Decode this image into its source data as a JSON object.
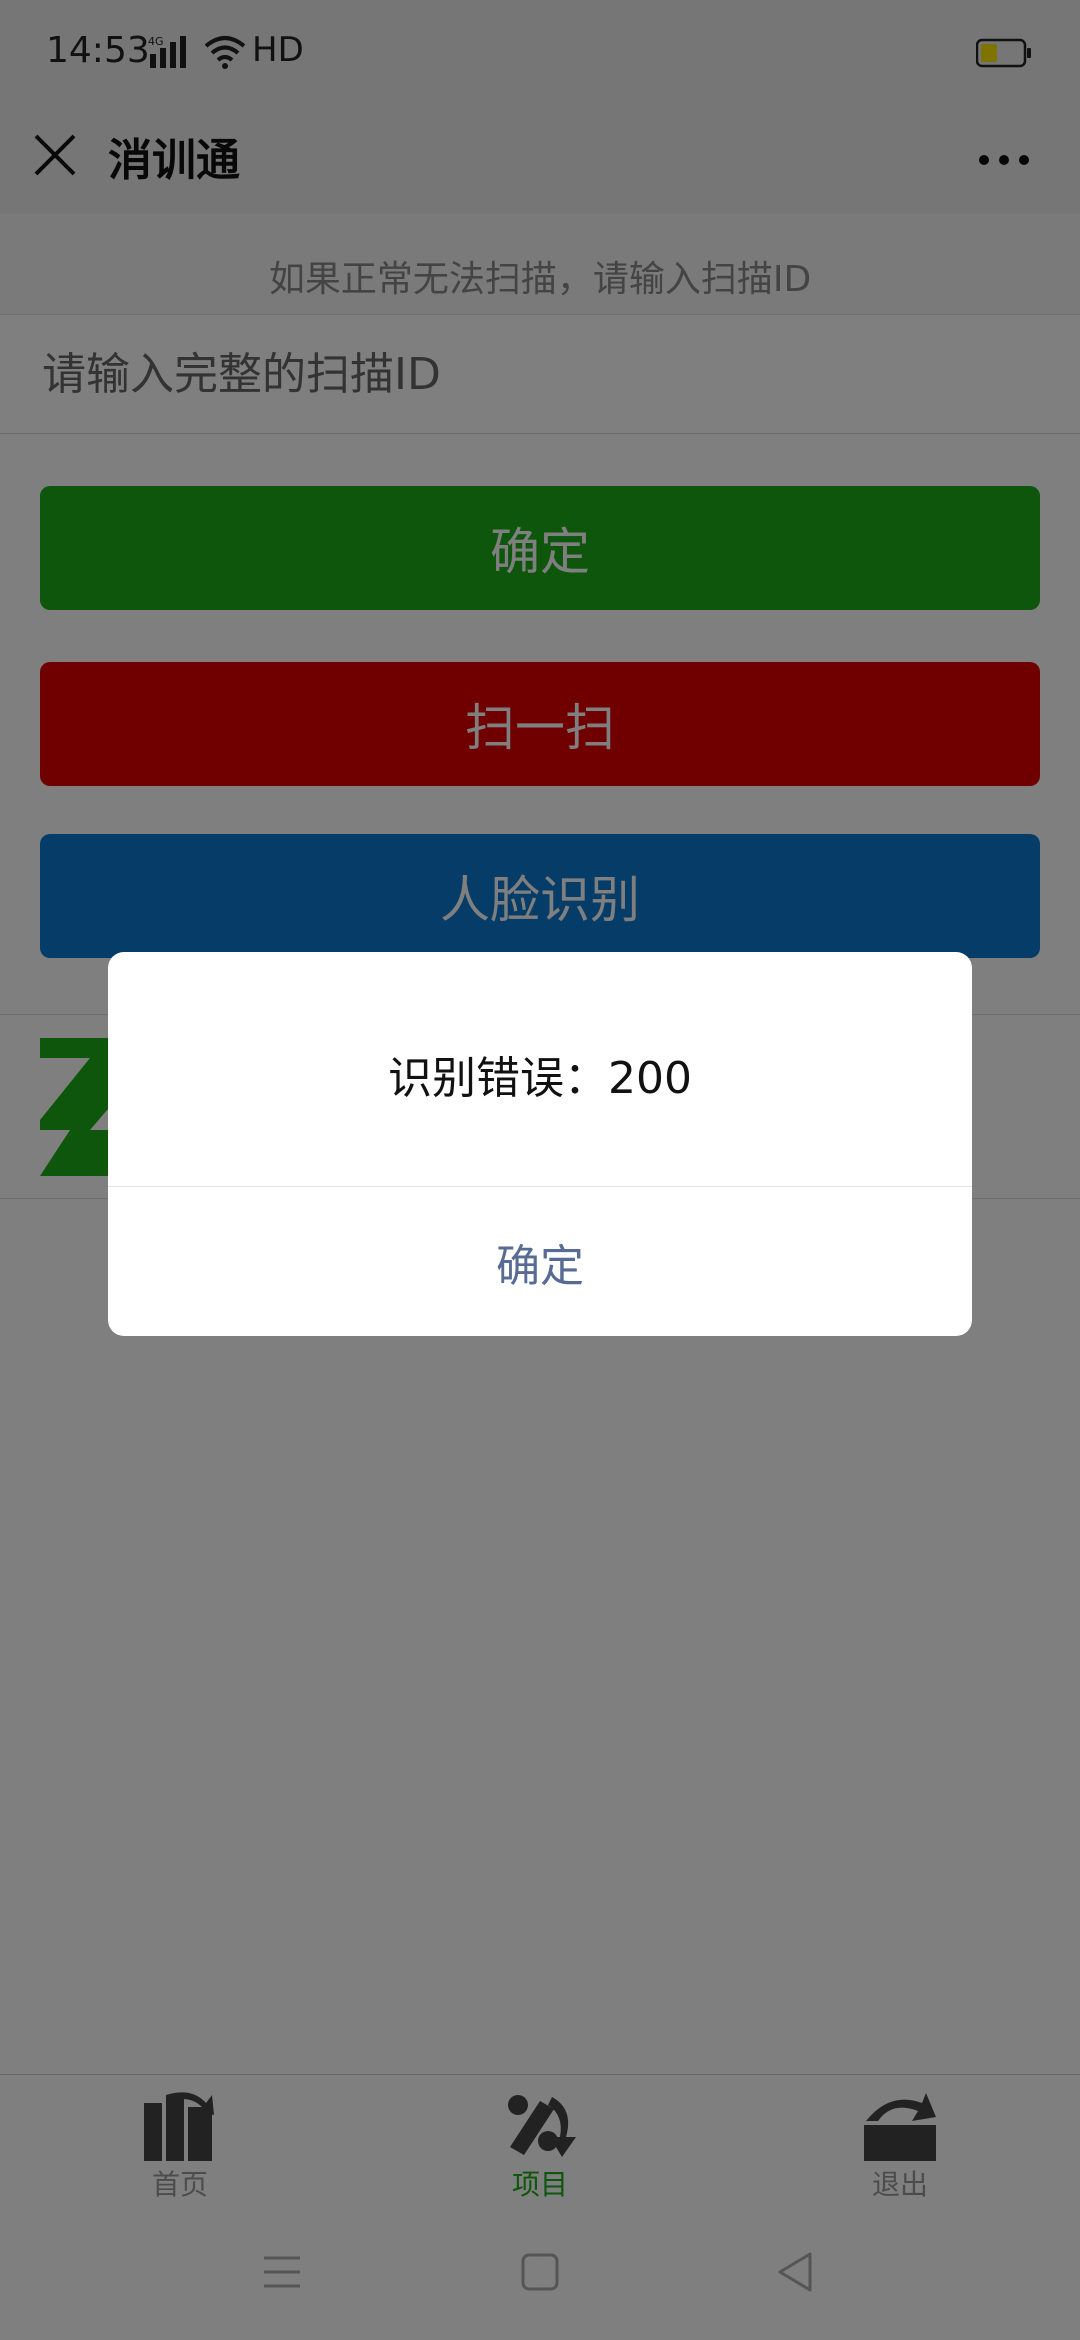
{
  "status_bar": {
    "time": "14:53",
    "network": "4G",
    "hd": "HD",
    "icons": [
      "signal-icon",
      "wifi-icon",
      "battery-icon"
    ]
  },
  "nav": {
    "title": "消训通",
    "close_icon": "close-icon",
    "more_icon": "more-icon"
  },
  "scan": {
    "hint": "如果正常无法扫描，请输入扫描ID",
    "placeholder": "请输入完整的扫描ID",
    "confirm_label": "确定",
    "scan_label": "扫一扫",
    "face_label": "人脸识别"
  },
  "dialog": {
    "message": "识别错误：200",
    "button_label": "确定"
  },
  "tabbar": {
    "items": [
      {
        "label": "首页",
        "icon": "books-icon",
        "active": false
      },
      {
        "label": "项目",
        "icon": "project-icon",
        "active": true
      },
      {
        "label": "退出",
        "icon": "logout-icon",
        "active": false
      }
    ]
  },
  "colors": {
    "confirm": "#1aad19",
    "scan": "#e00000",
    "face": "#0a7ad0",
    "dialog_button": "#576b95",
    "tab_active": "#1aad19"
  }
}
